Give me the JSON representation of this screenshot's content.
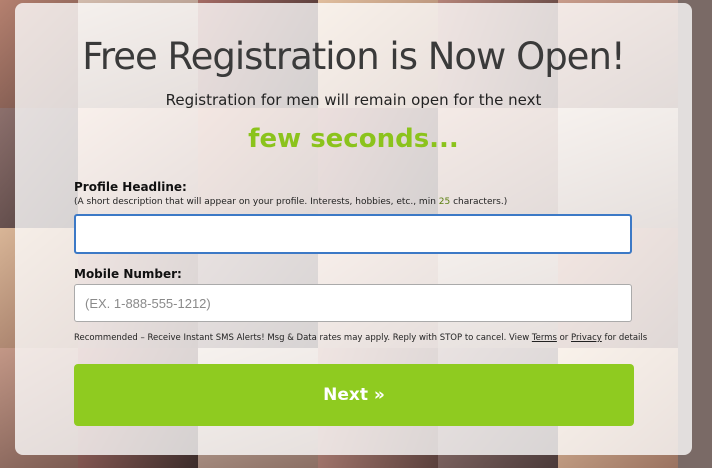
{
  "modal": {
    "title": "Free Registration is Now Open!",
    "subtitle": "Registration for men will remain open for the next",
    "countdown": "few seconds..."
  },
  "form": {
    "headline": {
      "label": "Profile Headline:",
      "hint_before": "(A short description that will appear on your profile. Interests, hobbies, etc., min ",
      "hint_min": "25",
      "hint_after": " characters.)",
      "value": ""
    },
    "mobile": {
      "label": "Mobile Number:",
      "placeholder": "(EX. 1-888-555-1212)",
      "value": ""
    },
    "sms_note": {
      "text": "Recommended – Receive Instant SMS Alerts! Msg & Data rates may apply. Reply with STOP to cancel. View ",
      "terms_link": "Terms",
      "or": " or ",
      "privacy_link": "Privacy",
      "after": " for details"
    },
    "next_button": "Next »"
  },
  "colors": {
    "accent_green": "#8fcb20",
    "countdown_green": "#8bc31c",
    "focus_blue": "#3c79c6"
  }
}
